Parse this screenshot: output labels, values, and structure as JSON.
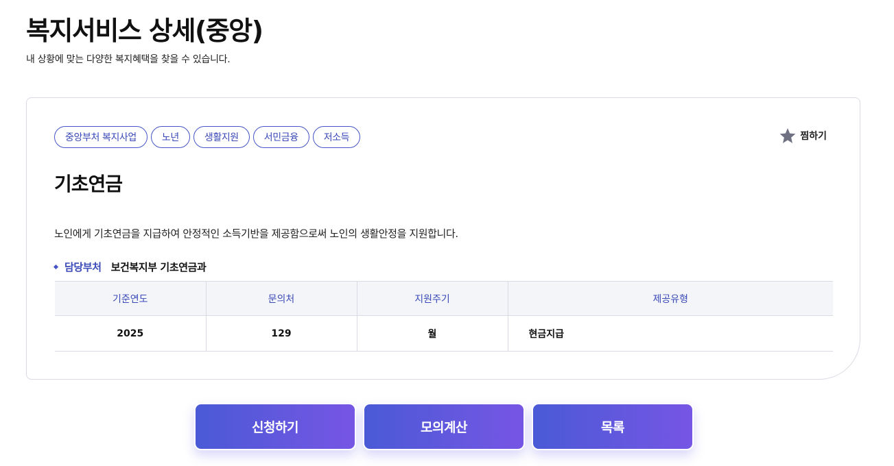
{
  "header": {
    "title": "복지서비스 상세(중앙)",
    "subtitle": "내 상황에 맞는 다양한 복지혜택을 찾을 수 있습니다."
  },
  "service": {
    "tags": [
      "중앙부처 복지사업",
      "노년",
      "생활지원",
      "서민금융",
      "저소득"
    ],
    "favorite_label": "찜하기",
    "favorite_icon": "star-icon",
    "title": "기초연금",
    "description": "노인에게 기초연금을 지급하여 안정적인 소득기반을 제공함으로써 노인의 생활안정을 지원합니다.",
    "department_label": "담당부처",
    "department_value": "보건복지부 기초연금과",
    "table": {
      "headers": [
        "기준연도",
        "문의처",
        "지원주기",
        "제공유형"
      ],
      "row": [
        "2025",
        "129",
        "월",
        "현금지급"
      ]
    }
  },
  "actions": {
    "apply_label": "신청하기",
    "simulate_label": "모의계산",
    "list_label": "목록"
  },
  "colors": {
    "accent": "#3a49b8",
    "button_gradient_start": "#4a5ad6",
    "button_gradient_end": "#7656e4",
    "table_header_bg": "#f4f5f9",
    "border": "#d8dbe3"
  }
}
